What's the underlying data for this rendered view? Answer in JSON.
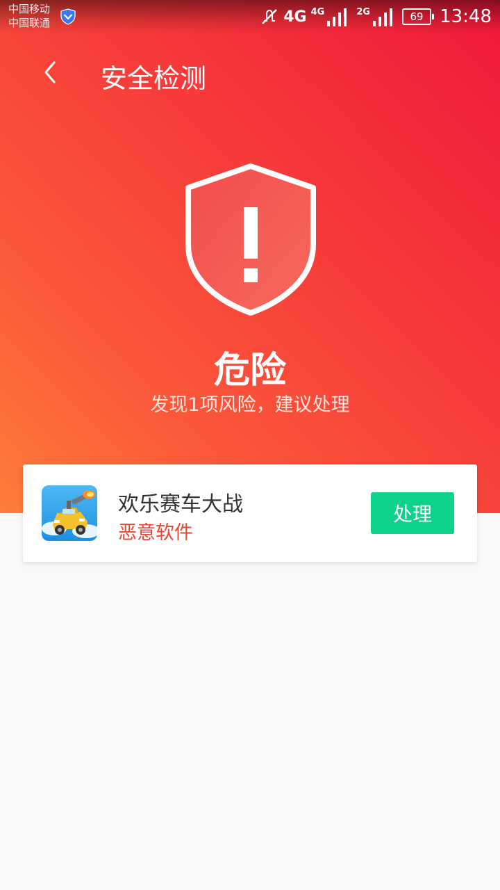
{
  "status_bar": {
    "carrier_1": "中国移动",
    "carrier_2": "中国联通",
    "net_1_label": "4G",
    "net_2_label": "4G",
    "net_3_label": "2G",
    "battery": "69",
    "time": "13:48",
    "icons": [
      "security-shield-icon",
      "mute-icon",
      "4g-data-icon",
      "signal-icon",
      "signal-icon",
      "battery-icon"
    ]
  },
  "header": {
    "title": "安全检测",
    "back_icon": "chevron-left-icon"
  },
  "scan_result": {
    "status": "危险",
    "description": "发现1项风险，建议处理",
    "icon": "danger-shield-icon"
  },
  "risk_item": {
    "app_name": "欢乐赛车大战",
    "risk_type": "恶意软件",
    "action_label": "处理"
  },
  "colors": {
    "gradient_top": "#f0183a",
    "gradient_bottom": "#fe7d38",
    "risk_red": "#ee4433",
    "action_green": "#0dd28b"
  }
}
